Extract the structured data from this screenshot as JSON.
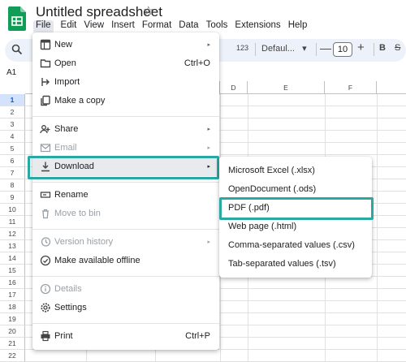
{
  "header": {
    "title": "Untitled spreadsheet",
    "star": "☆",
    "menus": [
      "File",
      "Edit",
      "View",
      "Insert",
      "Format",
      "Data",
      "Tools",
      "Extensions",
      "Help"
    ]
  },
  "toolbar": {
    "search_icon": "search-icon",
    "number_format": "123",
    "font": "Defaul...",
    "font_dropdown": "▾",
    "minus": "—",
    "font_size": "10",
    "plus": "+",
    "bold": "B",
    "strikethrough": "S"
  },
  "sheet": {
    "name_box": "A1",
    "columns": [
      "D",
      "E",
      "F"
    ],
    "rows": [
      "1",
      "2",
      "3",
      "4",
      "5",
      "6",
      "7",
      "8",
      "9",
      "10",
      "11",
      "12",
      "13",
      "14",
      "15",
      "16",
      "17",
      "18",
      "19",
      "20",
      "21",
      "22"
    ]
  },
  "file_menu": {
    "items": [
      {
        "label": "New",
        "icon": "new-sheet-icon",
        "arrow": "▸"
      },
      {
        "label": "Open",
        "icon": "folder-icon",
        "shortcut": "Ctrl+O"
      },
      {
        "label": "Import",
        "icon": "import-icon"
      },
      {
        "label": "Make a copy",
        "icon": "copy-icon"
      },
      {
        "label": "Share",
        "icon": "share-icon",
        "arrow": "▸"
      },
      {
        "label": "Email",
        "icon": "email-icon",
        "arrow": "▸",
        "disabled": true
      },
      {
        "label": "Download",
        "icon": "download-icon",
        "arrow": "▸",
        "highlighted": true
      },
      {
        "label": "Rename",
        "icon": "rename-icon"
      },
      {
        "label": "Move to bin",
        "icon": "trash-icon",
        "disabled": true
      },
      {
        "label": "Version history",
        "icon": "history-icon",
        "arrow": "▸",
        "disabled": true
      },
      {
        "label": "Make available offline",
        "icon": "offline-icon"
      },
      {
        "label": "Details",
        "icon": "info-icon",
        "disabled": true
      },
      {
        "label": "Settings",
        "icon": "gear-icon"
      },
      {
        "label": "Print",
        "icon": "print-icon",
        "shortcut": "Ctrl+P"
      }
    ]
  },
  "download_menu": {
    "items": [
      {
        "label": "Microsoft Excel (.xlsx)"
      },
      {
        "label": "OpenDocument (.ods)"
      },
      {
        "label": "PDF (.pdf)",
        "highlighted": true
      },
      {
        "label": "Web page (.html)"
      },
      {
        "label": "Comma-separated values (.csv)"
      },
      {
        "label": "Tab-separated values (.tsv)"
      }
    ]
  },
  "colors": {
    "highlight_border": "#2aa8a4",
    "sheets_green": "#0f9d58",
    "toolbar_bg": "#edf2fa",
    "selected_row": "#d3e3fd"
  }
}
